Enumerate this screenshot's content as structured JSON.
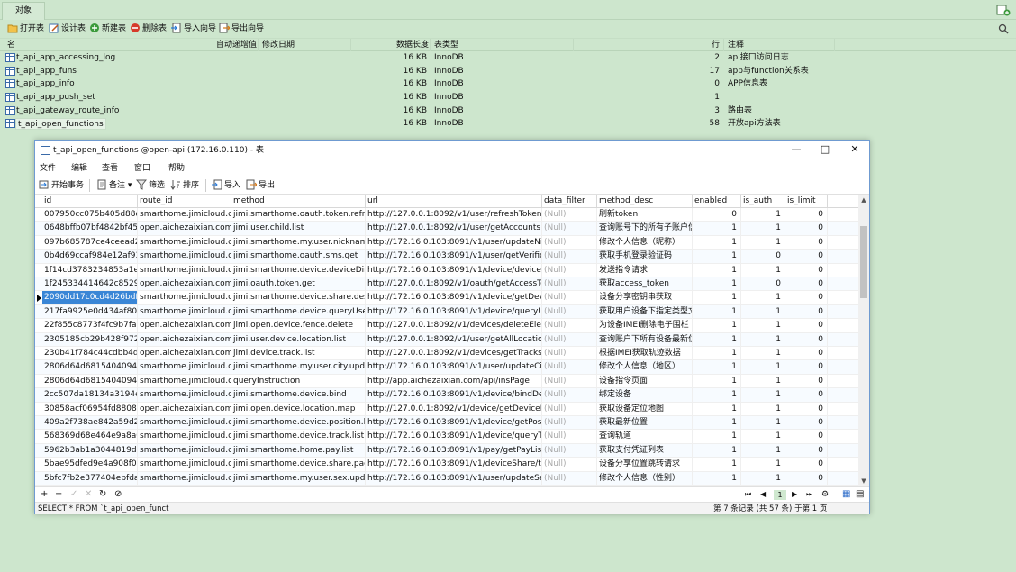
{
  "tabs": {
    "objects": "对象"
  },
  "toolbar": {
    "open": "打开表",
    "design": "设计表",
    "new": "新建表",
    "delete": "删除表",
    "import": "导入向导",
    "export": "导出向导"
  },
  "object_list": {
    "headers": [
      "名",
      "自动递增值",
      "修改日期",
      "数据长度",
      "表类型",
      "行",
      "注释"
    ],
    "rows": [
      {
        "name": "t_api_app_accessing_log",
        "size": "16 KB",
        "engine": "InnoDB",
        "rows": "2",
        "comment": "api接口访问日志"
      },
      {
        "name": "t_api_app_funs",
        "size": "16 KB",
        "engine": "InnoDB",
        "rows": "17",
        "comment": "app与function关系表"
      },
      {
        "name": "t_api_app_info",
        "size": "16 KB",
        "engine": "InnoDB",
        "rows": "0",
        "comment": "APP信息表"
      },
      {
        "name": "t_api_app_push_set",
        "size": "16 KB",
        "engine": "InnoDB",
        "rows": "1",
        "comment": ""
      },
      {
        "name": "t_api_gateway_route_info",
        "size": "16 KB",
        "engine": "InnoDB",
        "rows": "3",
        "comment": "路由表"
      },
      {
        "name": "t_api_open_functions",
        "size": "16 KB",
        "engine": "InnoDB",
        "rows": "58",
        "comment": "开放api方法表"
      }
    ]
  },
  "window": {
    "title": "t_api_open_functions @open-api (172.16.0.110) - 表",
    "menu": [
      "文件",
      "编辑",
      "查看",
      "窗口",
      "帮助"
    ],
    "toolbar": {
      "begin_tx": "开始事务",
      "note": "备注",
      "filter": "筛选",
      "sort": "排序",
      "import": "导入",
      "export": "导出"
    },
    "columns": [
      "id",
      "route_id",
      "method",
      "url",
      "data_filter",
      "method_desc",
      "enabled",
      "is_auth",
      "is_limit"
    ],
    "rows": [
      [
        "007950cc075b405d88d26",
        "smarthome.jimicloud.com",
        "jimi.smarthome.oauth.token.refresh",
        "http://127.0.0.1:8092/v1/user/refreshToken",
        "(Null)",
        "刷新token",
        "0",
        "1",
        "0"
      ],
      [
        "0648bffb07bf4842bf4581",
        "open.aichezaixian.com",
        "jimi.user.child.list",
        "http://127.0.0.1:8092/v1/user/getAccounts",
        "(Null)",
        "查询账号下的所有子账户信息",
        "1",
        "1",
        "0"
      ],
      [
        "097b685787ce4ceead215",
        "smarthome.jimicloud.com",
        "jimi.smarthome.my.user.nickname.update",
        "http://172.16.0.103:8091/v1/user/updateNickName",
        "(Null)",
        "修改个人信息（昵称）",
        "1",
        "1",
        "0"
      ],
      [
        "0b4d69ccaf984e12af93d4",
        "smarthome.jimicloud.com",
        "jimi.smarthome.oauth.sms.get",
        "http://172.16.0.103:8091/v1/user/getVerificationCode",
        "(Null)",
        "获取手机登录验证码",
        "1",
        "0",
        "0"
      ],
      [
        "1f14cd3783234853a1e39",
        "smarthome.jimicloud.com",
        "jimi.smarthome.device.deviceDirective",
        "http://172.16.0.103:8091/v1/device/deviceDirective",
        "(Null)",
        "发送指令请求",
        "1",
        "1",
        "0"
      ],
      [
        "1f245334414642c852943",
        "open.aichezaixian.com",
        "jimi.oauth.token.get",
        "http://127.0.0.1:8092/v1/oauth/getAccessToken",
        "(Null)",
        "获取access_token",
        "1",
        "0",
        "0"
      ],
      [
        "2090dd17c0cd4d26bdf5a",
        "smarthome.jimicloud.com",
        "jimi.smarthome.device.share.des.get",
        "http://172.16.0.103:8091/v1/device/getDeviceinfo",
        "(Null)",
        "设备分享密钥串获取",
        "1",
        "1",
        "0"
      ],
      [
        "217fa9925e0d434af801d",
        "smarthome.jimicloud.com",
        "jimi.smarthome.device.queryUserFile",
        "http://172.16.0.103:8091/v1/device/queryUserFile",
        "(Null)",
        "获取用户设备下指定类型文件",
        "1",
        "1",
        "0"
      ],
      [
        "22f855c8773f4fc9b7fa630",
        "open.aichezaixian.com",
        "jimi.open.device.fence.delete",
        "http://127.0.0.1:8092/v1/devices/deleteElectricFence",
        "(Null)",
        "为设备IMEI删除电子围栏",
        "1",
        "1",
        "0"
      ],
      [
        "2305185cb29b428f97268",
        "open.aichezaixian.com",
        "jimi.user.device.location.list",
        "http://127.0.0.1:8092/v1/user/getAllLocations",
        "(Null)",
        "查询账户下所有设备最新位置",
        "1",
        "1",
        "0"
      ],
      [
        "230b41f784c44cdbb4d8f4",
        "open.aichezaixian.com",
        "jimi.device.track.list",
        "http://127.0.0.1:8092/v1/devices/getTracks",
        "(Null)",
        "根据IMEI获取轨迹数据",
        "1",
        "1",
        "0"
      ],
      [
        "2806d64d6815404094631",
        "smarthome.jimicloud.com",
        "jimi.smarthome.my.user.city.update",
        "http://172.16.0.103:8091/v1/user/updateCityName",
        "(Null)",
        "修改个人信息（地区）",
        "1",
        "1",
        "0"
      ],
      [
        "2806d64d6815404094631",
        "smarthome.jimicloud.com",
        "queryInstruction",
        "http://app.aichezaixian.com/api/insPage",
        "(Null)",
        "设备指令页面",
        "1",
        "1",
        "0"
      ],
      [
        "2cc507da18134a3194e92",
        "smarthome.jimicloud.com",
        "jimi.smarthome.device.bind",
        "http://172.16.0.103:8091/v1/device/bindDevice",
        "(Null)",
        "绑定设备",
        "1",
        "1",
        "0"
      ],
      [
        "30858acf06954fd880805c",
        "open.aichezaixian.com",
        "jimi.open.device.location.map",
        "http://127.0.0.1:8092/v1/device/getDeviceLocation",
        "(Null)",
        "获取设备定位地图",
        "1",
        "1",
        "0"
      ],
      [
        "409a2f738ae842a59d29b",
        "smarthome.jimicloud.com",
        "jimi.smarthome.device.position.list",
        "http://172.16.0.103:8091/v1/device/getPositionList",
        "(Null)",
        "获取最新位置",
        "1",
        "1",
        "0"
      ],
      [
        "568369d68e464e9a8a04e",
        "smarthome.jimicloud.com",
        "jimi.smarthome.device.track.list",
        "http://172.16.0.103:8091/v1/device/queryTrackByImei",
        "(Null)",
        "查询轨道",
        "1",
        "1",
        "0"
      ],
      [
        "5962b3ab1a3044819d7fd",
        "smarthome.jimicloud.com",
        "jimi.smarthome.home.pay.list",
        "http://172.16.0.103:8091/v1/pay/getPayList",
        "(Null)",
        "获取支付凭证列表",
        "1",
        "1",
        "0"
      ],
      [
        "5bae95dfed9e4a908f0b3",
        "smarthome.jimicloud.com",
        "jimi.smarthome.device.share.page",
        "http://172.16.0.103:8091/v1/deviceShare/trackDevice",
        "(Null)",
        "设备分享位置跳转请求",
        "1",
        "1",
        "0"
      ],
      [
        "5bfc7fb2e377404ebfdac8",
        "smarthome.jimicloud.com",
        "jimi.smarthome.my.user.sex.update",
        "http://172.16.0.103:8091/v1/user/updateSex",
        "(Null)",
        "修改个人信息（性别）",
        "1",
        "1",
        "0"
      ]
    ],
    "current_row": 6,
    "page": "1",
    "status_sql": "SELECT * FROM `t_api_open_funct",
    "record_info": "第 7 条记录 (共 57 条) 于第 1 页"
  },
  "colors": {
    "background": "#cde6cd",
    "selection": "#3a86d6",
    "window_border": "#6f9bd1"
  }
}
